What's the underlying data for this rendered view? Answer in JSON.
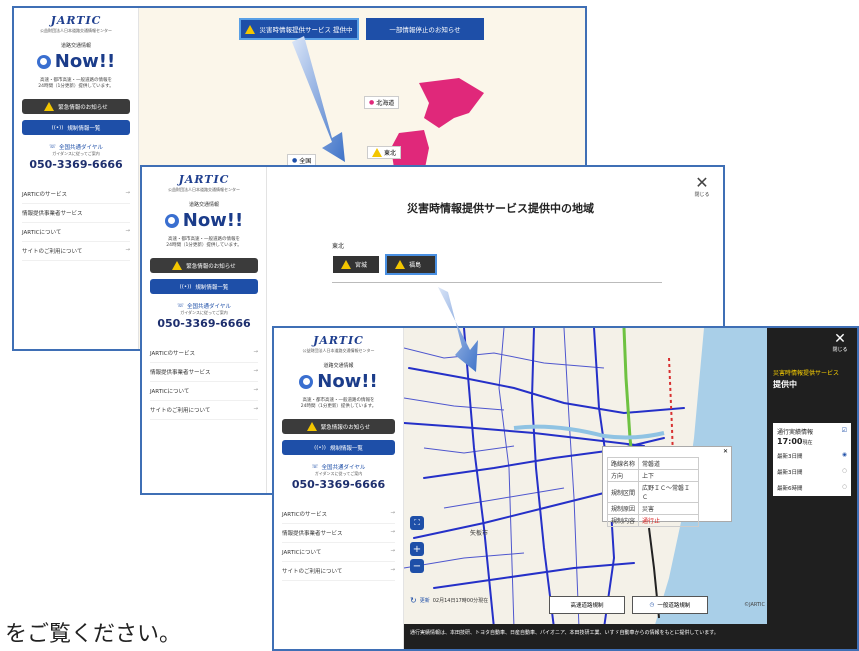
{
  "colors": {
    "brand_blue": "#1e4fa8",
    "warning_yellow": "#f3c600",
    "map_pink": "#e0287a",
    "frame_blue": "#3f6fb5",
    "dark_panel": "#1f1f1f"
  },
  "sidebar": {
    "logo": "JARTIC",
    "org": "公益財団法人日本道路交通情報センター",
    "brand_small": "道路交通情報",
    "brand": "Now!!",
    "desc_line1": "高速・都市高速・一般道路の情報を",
    "desc_line2": "24時間（1分更新）提供しています。",
    "emergency_button": "緊急情報のお知らせ",
    "closure_button": "規制情報一覧",
    "dial_label": "全国共通ダイヤル",
    "dial_sub": "ガイダンスに従ってご案内",
    "phone": "050-3369-6666",
    "menu": [
      {
        "label": "JARTICのサービス"
      },
      {
        "label": "情報提供事業者サービス"
      },
      {
        "label": "JARTICについて"
      },
      {
        "label": "サイトのご利用について"
      }
    ]
  },
  "shot1": {
    "disaster_button": "災害時情報提供サービス 提供中",
    "suspend_button": "一部情報停止のお知らせ",
    "region_hokkaido": "北海道",
    "region_tohoku": "東北",
    "region_nationwide": "全国"
  },
  "shot2": {
    "title": "災害時情報提供サービス提供中の地域",
    "close_label": "閉じる",
    "region": "東北",
    "pref_miyagi": "宮城",
    "pref_fukushima": "福島"
  },
  "shot3": {
    "panel_title": "災害時情報提供サービス",
    "panel_status": "提供中",
    "close_label": "閉じる",
    "traffic_label": "通行実績情報",
    "traffic_time": "17:00",
    "traffic_suffix": "現在",
    "opt1": "最新3日間",
    "opt2": "最新3日間",
    "opt3": "最新6時間",
    "popup_rows": [
      {
        "k": "路線名称",
        "v": "常磐道"
      },
      {
        "k": "方向",
        "v": "上下"
      },
      {
        "k": "規制区間",
        "v": "広野ＩＣ～常磐ＩＣ"
      },
      {
        "k": "規制原因",
        "v": "災害"
      },
      {
        "k": "規制内容",
        "v": "通行止"
      }
    ],
    "updated_label": "更新",
    "updated_time": "02月14日17時00分現在",
    "btn_highway": "高速道路規制",
    "btn_general": "一般道路規制",
    "copyright": "©JARTIC",
    "city_label": "矢板市",
    "footer_note": "通行実績情報は、本田技研、トヨタ自動車、日産自動車、パイオニア、本田技研工業、いすゞ自動車からの情報をもとに提供しています。"
  },
  "caption": "をご覧ください。"
}
